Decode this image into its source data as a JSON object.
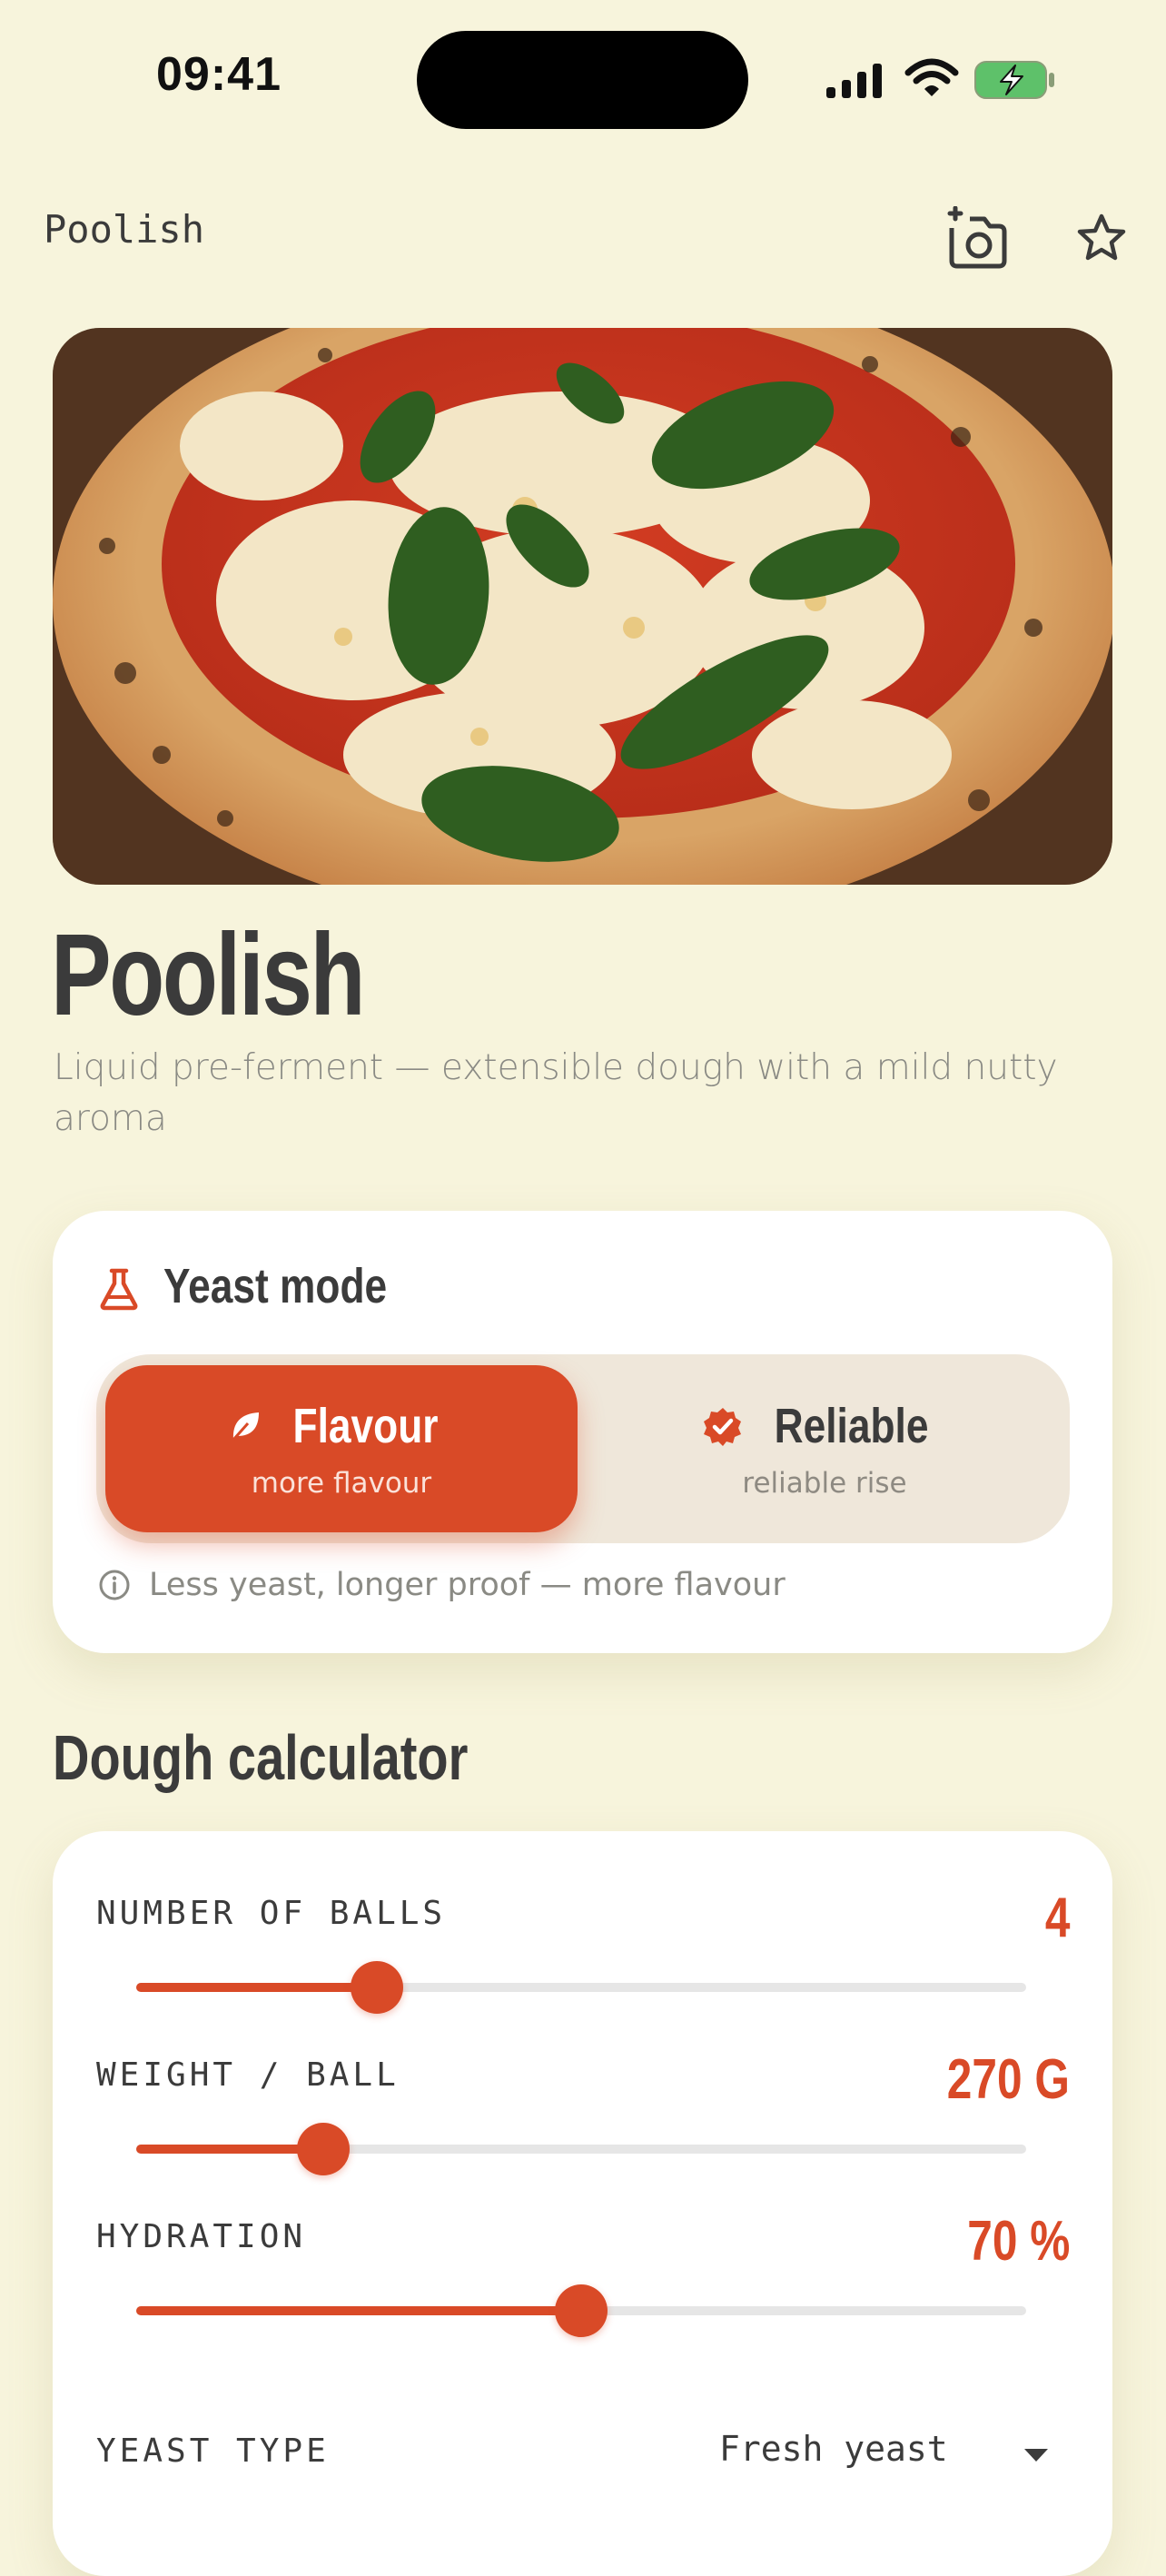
{
  "status_bar": {
    "time": "09:41"
  },
  "app_bar": {
    "title": "Poolish",
    "icons": [
      "add-photo-icon",
      "star-icon"
    ]
  },
  "recipe": {
    "title": "Poolish",
    "subtitle": "Liquid pre-ferment — extensible dough with a mild nutty aroma"
  },
  "yeast_mode": {
    "heading": "Yeast mode",
    "options": [
      {
        "label": "Flavour",
        "sublabel": "more flavour",
        "icon": "leaf-icon",
        "selected": true
      },
      {
        "label": "Reliable",
        "sublabel": "reliable rise",
        "icon": "verified-badge-icon",
        "selected": false
      }
    ],
    "hint": "Less yeast, longer proof — more flavour"
  },
  "calculator": {
    "title": "Dough calculator",
    "fields": [
      {
        "label": "NUMBER OF BALLS",
        "value": "4",
        "fraction": 0.27
      },
      {
        "label": "WEIGHT / BALL",
        "value": "270 G",
        "fraction": 0.21
      },
      {
        "label": "HYDRATION",
        "value": "70 %",
        "fraction": 0.5
      }
    ],
    "yeast_type": {
      "label": "YEAST TYPE",
      "value": "Fresh yeast"
    }
  },
  "colors": {
    "accent": "#d94a27",
    "background": "#f7f4dc",
    "card": "#ffffff",
    "segment_bg": "#efe7da",
    "text": "#3b3b3b"
  }
}
